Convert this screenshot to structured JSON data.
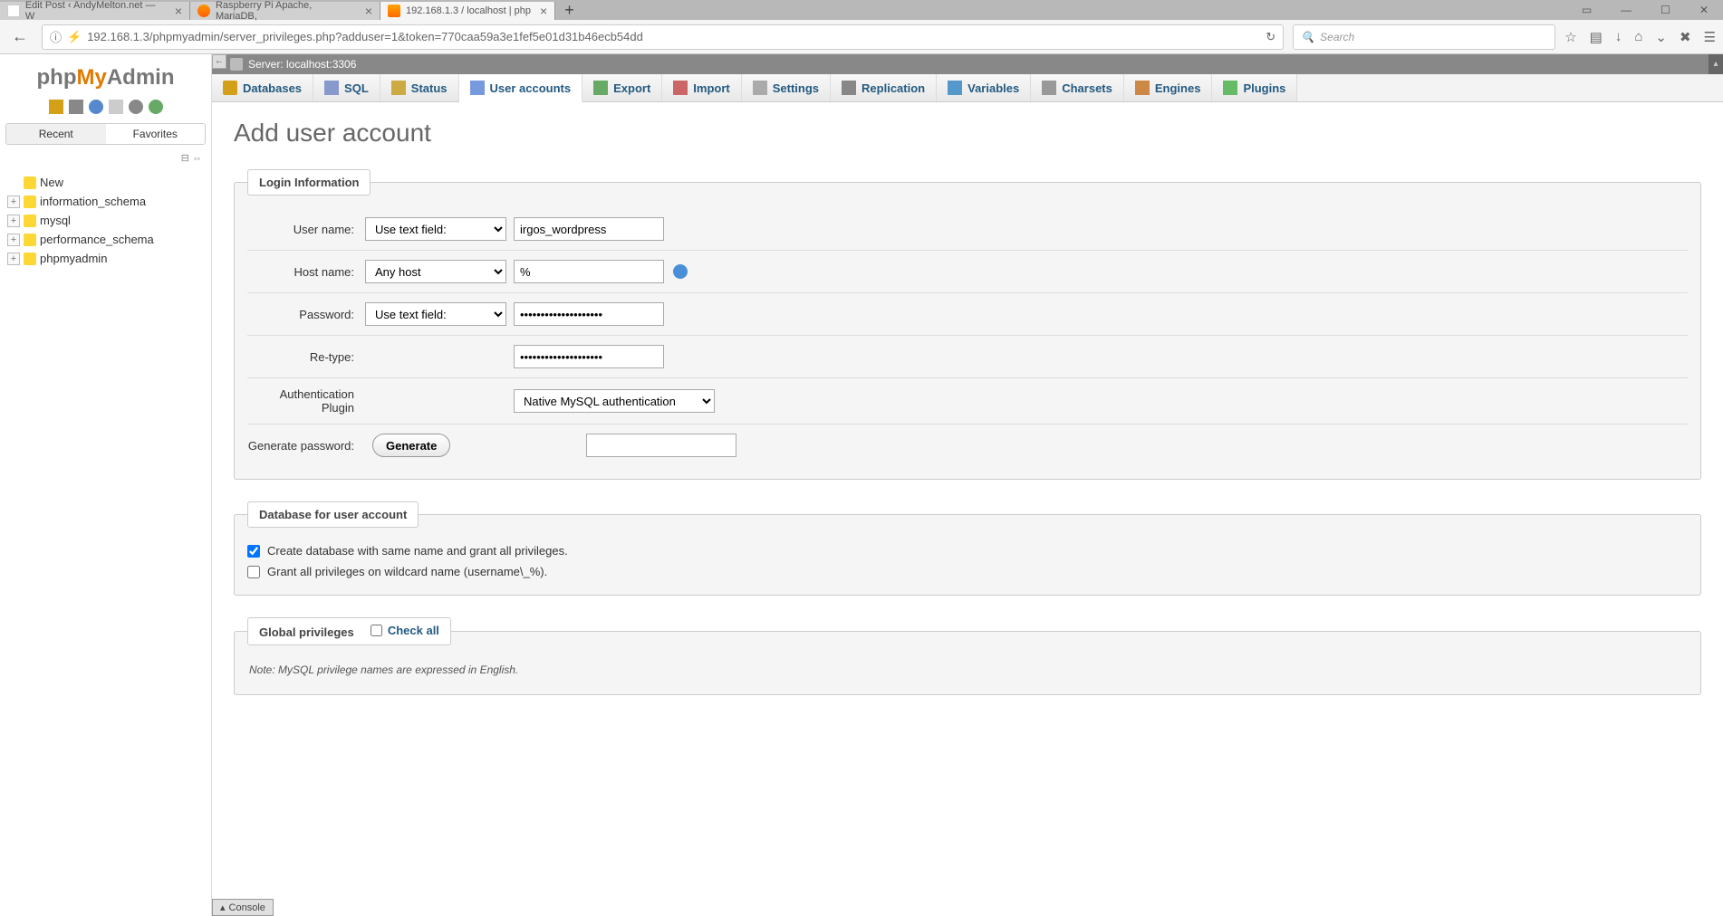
{
  "browser": {
    "tabs": [
      {
        "title": "Edit Post ‹ AndyMelton.net — W"
      },
      {
        "title": "Raspberry Pi Apache, MariaDB,"
      },
      {
        "title": "192.168.1.3 / localhost | php"
      }
    ],
    "url": "192.168.1.3/phpmyadmin/server_privileges.php?adduser=1&token=770caa59a3e1fef5e01d31b46ecb54dd",
    "search_placeholder": "Search"
  },
  "sidebar": {
    "logo": {
      "php": "php",
      "my": "My",
      "admin": "Admin"
    },
    "tabs": {
      "recent": "Recent",
      "favorites": "Favorites"
    },
    "new_label": "New",
    "databases": [
      "information_schema",
      "mysql",
      "performance_schema",
      "phpmyadmin"
    ]
  },
  "server": {
    "label": "Server: localhost:3306"
  },
  "top_tabs": [
    {
      "label": "Databases",
      "icon": "ico-db"
    },
    {
      "label": "SQL",
      "icon": "ico-sql"
    },
    {
      "label": "Status",
      "icon": "ico-status"
    },
    {
      "label": "User accounts",
      "icon": "ico-users",
      "active": true
    },
    {
      "label": "Export",
      "icon": "ico-export"
    },
    {
      "label": "Import",
      "icon": "ico-import"
    },
    {
      "label": "Settings",
      "icon": "ico-settings"
    },
    {
      "label": "Replication",
      "icon": "ico-repl"
    },
    {
      "label": "Variables",
      "icon": "ico-vars"
    },
    {
      "label": "Charsets",
      "icon": "ico-chars"
    },
    {
      "label": "Engines",
      "icon": "ico-eng"
    },
    {
      "label": "Plugins",
      "icon": "ico-plug"
    }
  ],
  "page": {
    "title": "Add user account",
    "login_legend": "Login Information",
    "fields": {
      "username_label": "User name:",
      "username_select": "Use text field:",
      "username_value": "irgos_wordpress",
      "hostname_label": "Host name:",
      "hostname_select": "Any host",
      "hostname_value": "%",
      "password_label": "Password:",
      "password_select": "Use text field:",
      "password_value": "••••••••••••••••••••",
      "retype_label": "Re-type:",
      "retype_value": "••••••••••••••••••••",
      "auth_label": "Authentication Plugin",
      "auth_select": "Native MySQL authentication",
      "genpw_label": "Generate password:",
      "gen_button": "Generate"
    },
    "db_legend": "Database for user account",
    "db_checks": {
      "create_db": "Create database with same name and grant all privileges.",
      "grant_wildcard": "Grant all privileges on wildcard name (username\\_%)."
    },
    "global_legend": "Global privileges",
    "check_all": "Check all",
    "note": "Note: MySQL privilege names are expressed in English.",
    "console": "Console"
  }
}
